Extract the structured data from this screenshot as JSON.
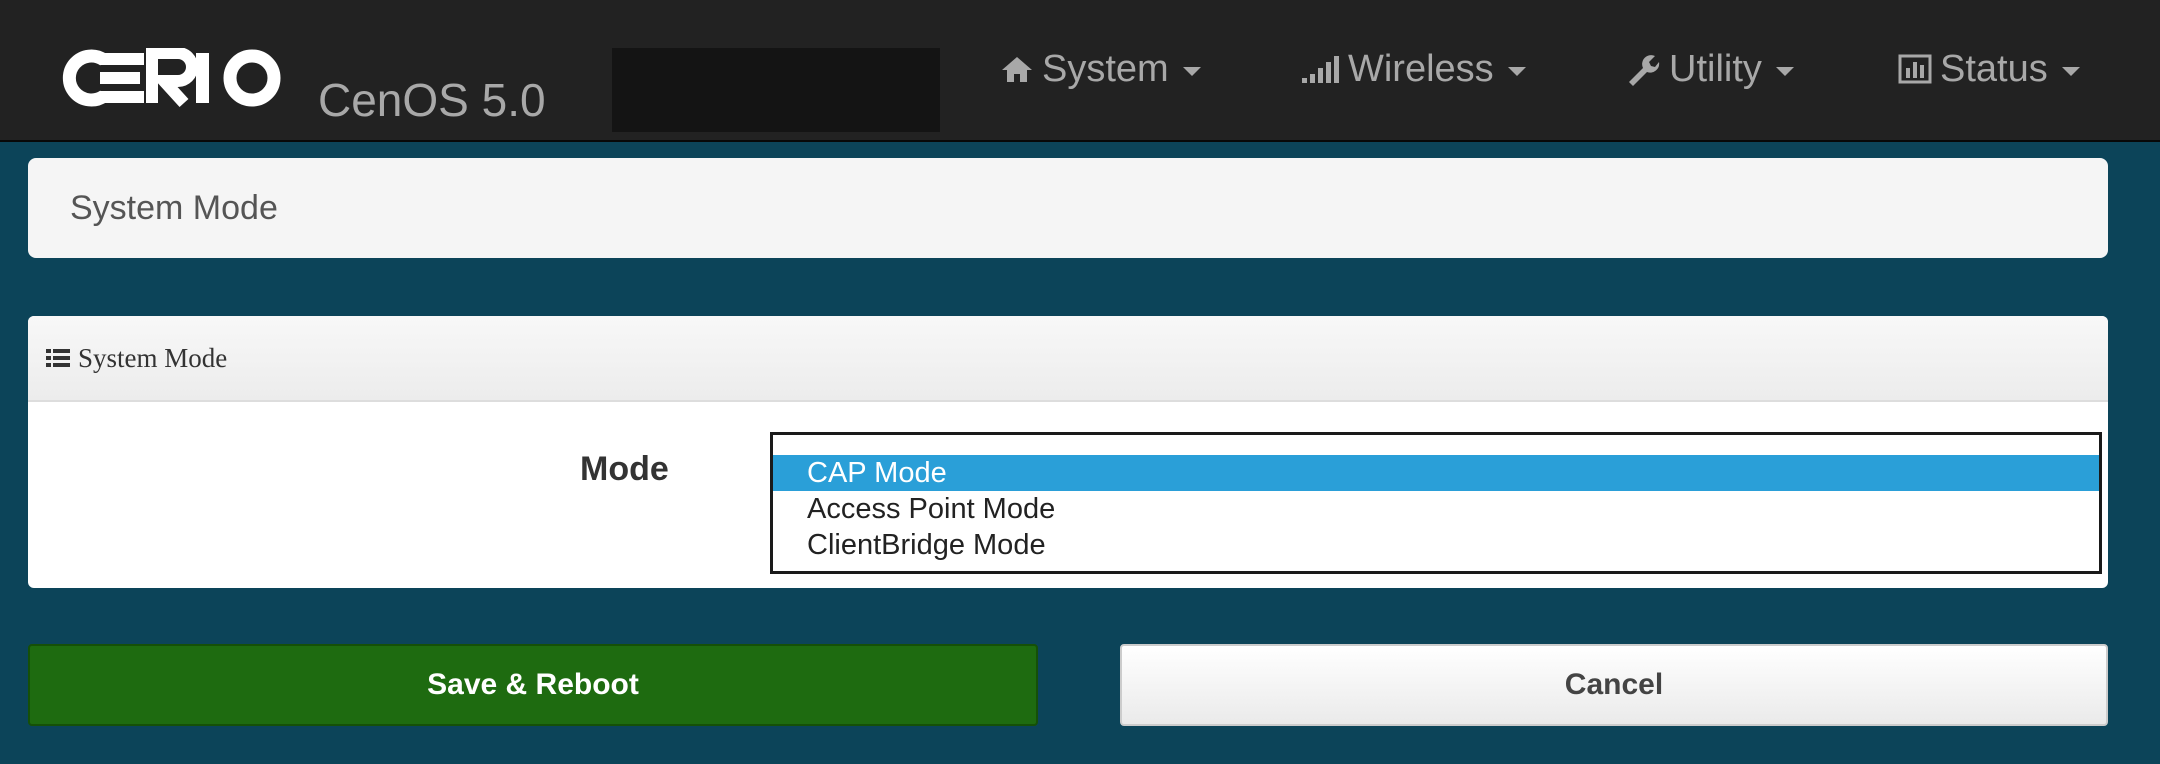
{
  "header": {
    "logo_text": "CERIO",
    "product_name": "CenOS 5.0",
    "nav": [
      {
        "label": "System",
        "icon": "home-icon"
      },
      {
        "label": "Wireless",
        "icon": "signal-bars-icon"
      },
      {
        "label": "Utility",
        "icon": "wrench-icon"
      },
      {
        "label": "Status",
        "icon": "bar-chart-icon"
      }
    ]
  },
  "page": {
    "title": "System Mode"
  },
  "panel": {
    "heading": "System Mode",
    "mode_label": "Mode",
    "options": [
      "CAP Mode",
      "Access Point Mode",
      "ClientBridge Mode"
    ],
    "selected": "CAP Mode"
  },
  "buttons": {
    "save": "Save & Reboot",
    "cancel": "Cancel"
  },
  "colors": {
    "navbar": "#222222",
    "background": "#0c4459",
    "save_button": "#1e6b10",
    "selected_option": "#2a9fd8"
  }
}
